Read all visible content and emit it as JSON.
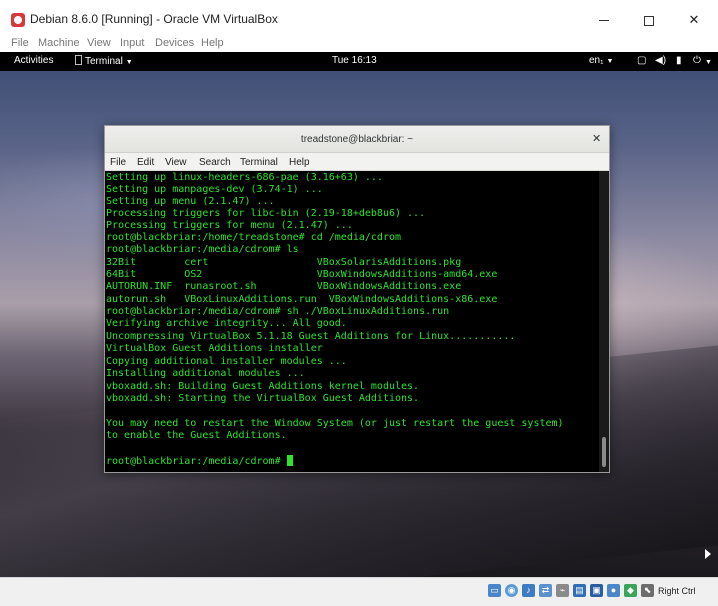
{
  "window": {
    "title": "Debian 8.6.0 [Running] - Oracle VM VirtualBox",
    "logo_icon": "virtualbox-debian-swirl-icon",
    "controls": {
      "minimize": "minimize-icon",
      "maximize": "maximize-icon",
      "close": "✕"
    }
  },
  "menubar": {
    "items": [
      "File",
      "Machine",
      "View",
      "Input",
      "Devices",
      "Help"
    ]
  },
  "guest_topbar": {
    "activities": "Activities",
    "app_menu": "Terminal",
    "clock": "Tue 16:13",
    "keyboard_layout": "en₁",
    "icons": [
      "screen-icon",
      "volume-icon",
      "battery-icon",
      "power-icon"
    ]
  },
  "terminal": {
    "title": "treadstone@blackbriar: ~",
    "close_label": "✕",
    "menu": [
      "File",
      "Edit",
      "View",
      "Search",
      "Terminal",
      "Help"
    ],
    "text_color": "#2ee22e",
    "lines": [
      "Setting up linux-headers-686-pae (3.16+63) ...",
      "Setting up manpages-dev (3.74-1) ...",
      "Setting up menu (2.1.47) ...",
      "Processing triggers for libc-bin (2.19-18+deb8u6) ...",
      "Processing triggers for menu (2.1.47) ...",
      "root@blackbriar:/home/treadstone# cd /media/cdrom",
      "root@blackbriar:/media/cdrom# ls",
      "32Bit        cert                  VBoxSolarisAdditions.pkg",
      "64Bit        OS2                   VBoxWindowsAdditions-amd64.exe",
      "AUTORUN.INF  runasroot.sh          VBoxWindowsAdditions.exe",
      "autorun.sh   VBoxLinuxAdditions.run  VBoxWindowsAdditions-x86.exe",
      "root@blackbriar:/media/cdrom# sh ./VBoxLinuxAdditions.run",
      "Verifying archive integrity... All good.",
      "Uncompressing VirtualBox 5.1.18 Guest Additions for Linux...........",
      "VirtualBox Guest Additions installer",
      "Copying additional installer modules ...",
      "Installing additional modules ...",
      "vboxadd.sh: Building Guest Additions kernel modules.",
      "vboxadd.sh: Starting the VirtualBox Guest Additions.",
      "",
      "You may need to restart the Window System (or just restart the guest system)",
      "to enable the Guest Additions.",
      "",
      "root@blackbriar:/media/cdrom# "
    ]
  },
  "status_bar": {
    "icons": [
      "hard-disk-icon",
      "optical-drive-icon",
      "audio-icon",
      "network-icon",
      "usb-icon",
      "shared-folders-icon",
      "display-icon",
      "video-capture-icon",
      "guest-additions-icon",
      "cpu-icon",
      "mouse-integration-icon",
      "keyboard-icon"
    ],
    "host_key": "Right Ctrl"
  }
}
